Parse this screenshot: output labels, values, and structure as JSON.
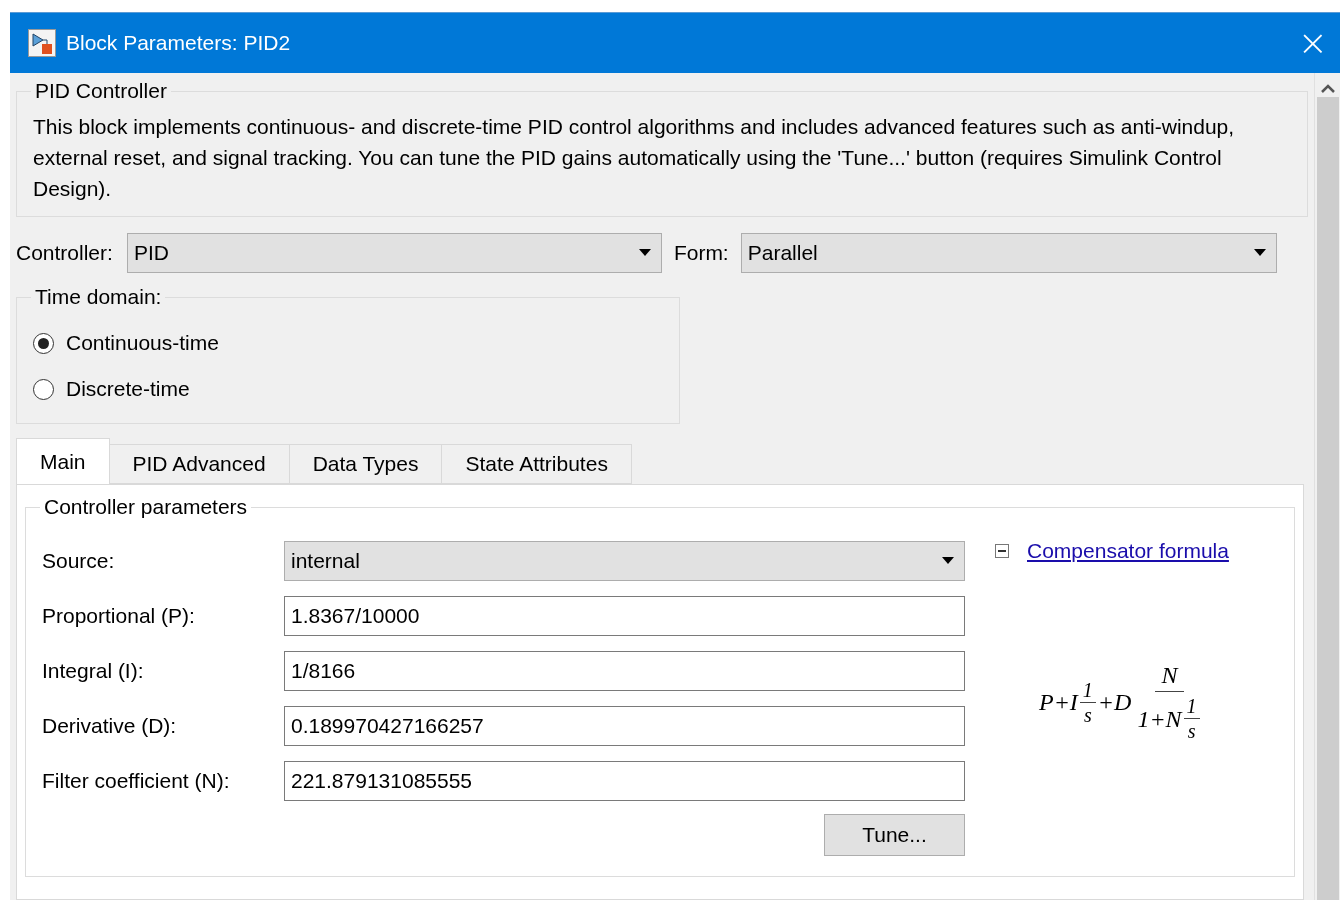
{
  "window": {
    "title": "Block Parameters: PID2",
    "close": "×"
  },
  "description": {
    "title": "PID Controller",
    "text": "This block implements continuous- and discrete-time PID control algorithms and includes advanced features such as anti-windup, external reset, and signal tracking. You can tune the PID gains automatically using the 'Tune...' button (requires Simulink Control Design)."
  },
  "controller": {
    "label": "Controller:",
    "value": "PID"
  },
  "form": {
    "label": "Form:",
    "value": "Parallel"
  },
  "time_domain": {
    "title": "Time domain:",
    "options": [
      {
        "label": "Continuous-time",
        "selected": true
      },
      {
        "label": "Discrete-time",
        "selected": false
      }
    ]
  },
  "tabs": [
    {
      "label": "Main",
      "selected": true
    },
    {
      "label": "PID Advanced",
      "selected": false
    },
    {
      "label": "Data Types",
      "selected": false
    },
    {
      "label": "State Attributes",
      "selected": false
    }
  ],
  "parameters": {
    "title": "Controller parameters",
    "fields": [
      {
        "kind": "dropdown",
        "label": "Source:",
        "value": "internal"
      },
      {
        "kind": "text",
        "label": "Proportional (P):",
        "value": "1.8367/10000"
      },
      {
        "kind": "text",
        "label": "Integral (I):",
        "value": "1/8166"
      },
      {
        "kind": "text",
        "label": "Derivative (D):",
        "value": "0.189970427166257"
      },
      {
        "kind": "text",
        "label": "Filter coefficient (N):",
        "value": "221.879131085555"
      }
    ],
    "tune_button": "Tune...",
    "formula_link": {
      "label": "Compensator formula",
      "expanded": true
    },
    "formula": {
      "lead": "P+I",
      "f1_num": "1",
      "f1_den": "s",
      "mid": "+D",
      "num": "N",
      "den_lead": "1+N",
      "f2_num": "1",
      "f2_den": "s"
    }
  }
}
